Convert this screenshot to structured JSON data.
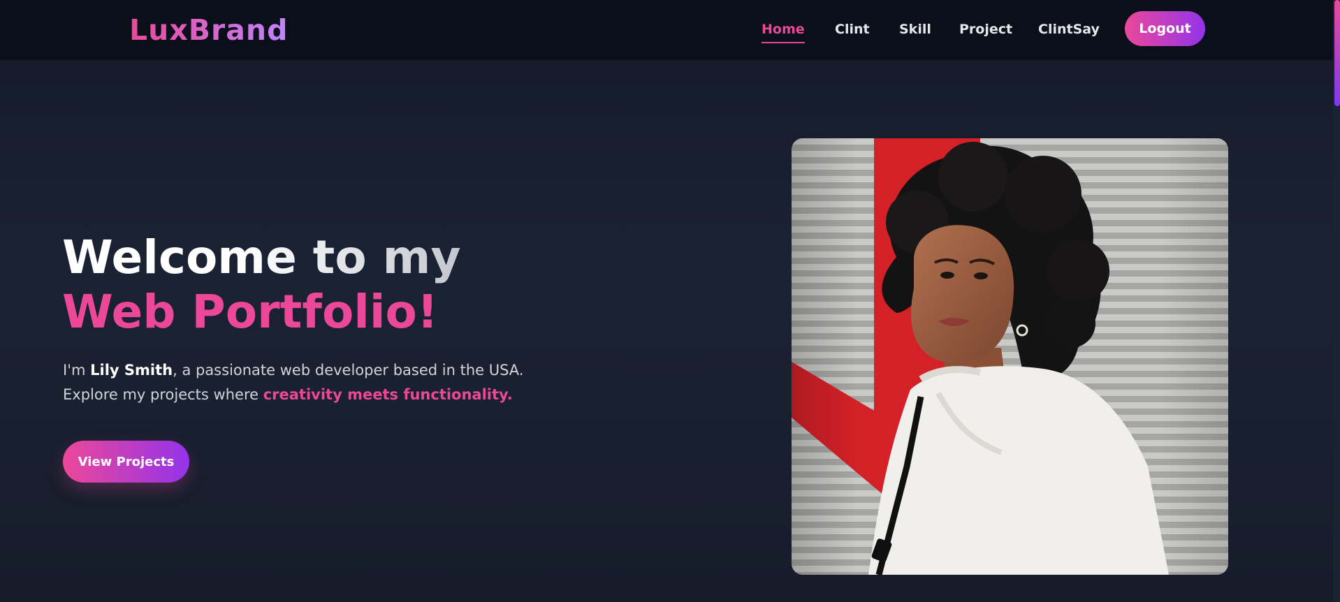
{
  "brand": {
    "logo_text": "LuxBrand"
  },
  "nav": {
    "items": [
      {
        "label": "Home",
        "active": true
      },
      {
        "label": "Clint",
        "active": false
      },
      {
        "label": "Skill",
        "active": false
      },
      {
        "label": "Project",
        "active": false
      },
      {
        "label": "ClintSay",
        "active": false
      }
    ],
    "logout_label": "Logout"
  },
  "hero": {
    "title_line1": "Welcome to my",
    "title_line2": "Web Portfolio!",
    "desc_prefix": "I'm ",
    "desc_name": "Lily Smith",
    "desc_middle": ", a passionate web developer based in the USA. Explore my projects where ",
    "desc_accent": "creativity meets functionality.",
    "cta_label": "View Projects"
  },
  "colors": {
    "accent_pink": "#ec4899",
    "accent_purple": "#9333ea",
    "nav_bg": "#0b0f19",
    "page_bg": "#171d2c"
  },
  "portrait": {
    "icon": "portrait-photo"
  }
}
